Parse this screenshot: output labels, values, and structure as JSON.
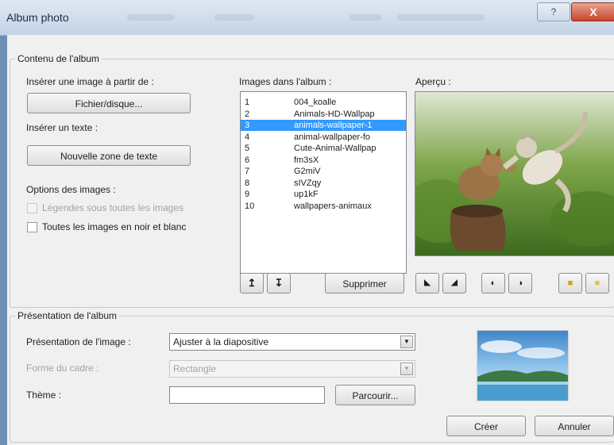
{
  "window": {
    "title": "Album photo",
    "help_glyph": "?",
    "close_glyph": "X"
  },
  "album_content": {
    "group_label": "Contenu de l'album",
    "insert_image_label": "Insérer une image à partir de :",
    "file_disk_button": "Fichier/disque...",
    "insert_text_label": "Insérer un texte :",
    "new_textbox_button": "Nouvelle zone de texte",
    "image_options_label": "Options des images :",
    "captions_checkbox": "Légendes sous toutes les images",
    "bw_checkbox": "Toutes les images en noir et blanc",
    "images_in_album_label": "Images dans l'album :",
    "preview_label": "Aperçu :",
    "images": [
      {
        "num": "1",
        "name": "004_koalle"
      },
      {
        "num": "2",
        "name": "Animals-HD-Wallpap"
      },
      {
        "num": "3",
        "name": "animals-wallpaper-1"
      },
      {
        "num": "4",
        "name": "animal-wallpaper-fo"
      },
      {
        "num": "5",
        "name": "Cute-Animal-Wallpap"
      },
      {
        "num": "6",
        "name": "fm3sX"
      },
      {
        "num": "7",
        "name": "G2miV"
      },
      {
        "num": "8",
        "name": "sIVZqy"
      },
      {
        "num": "9",
        "name": "up1kF"
      },
      {
        "num": "10",
        "name": "wallpapers-animaux"
      }
    ],
    "selected_index": 2,
    "move_up_glyph": "↥",
    "move_down_glyph": "↧",
    "remove_button": "Supprimer"
  },
  "album_layout": {
    "group_label": "Présentation de l'album",
    "image_layout_label": "Présentation de l'image :",
    "image_layout_value": "Ajuster à la diapositive",
    "frame_shape_label": "Forme du cadre :",
    "frame_shape_value": "Rectangle",
    "theme_label": "Thème :",
    "theme_value": "",
    "browse_button": "Parcourir..."
  },
  "footer": {
    "create_button": "Créer",
    "cancel_button": "Annuler"
  },
  "colors": {
    "selection": "#3399ff",
    "title_text": "#1b2d4a",
    "close_button": "#c8452c"
  }
}
